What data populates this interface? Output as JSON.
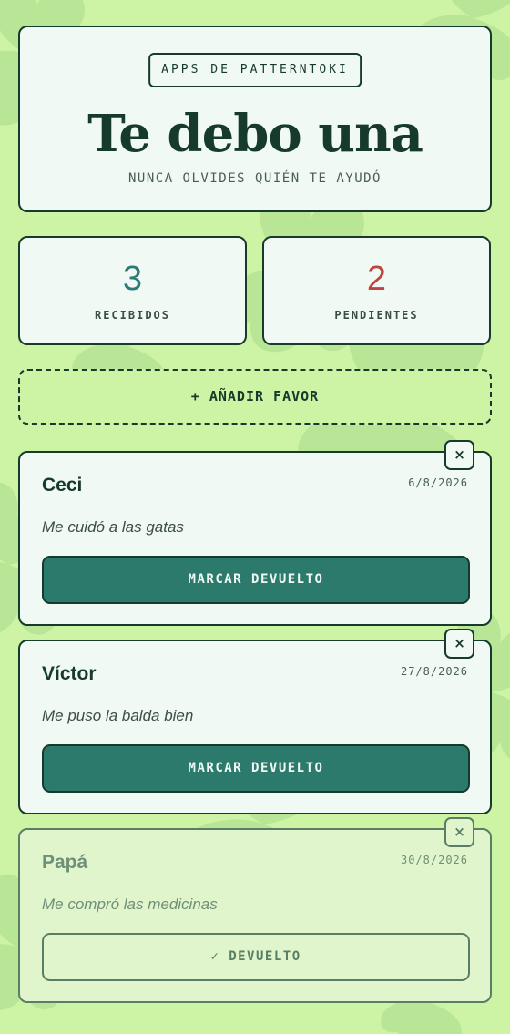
{
  "header": {
    "brand": "APPS DE PATTERNTOKI",
    "title": "Te debo una",
    "subtitle": "NUNCA OLVIDES QUIÉN TE AYUDÓ"
  },
  "stats": {
    "received": {
      "value": "3",
      "label": "RECIBIDOS",
      "color": "#2b7a78"
    },
    "pending": {
      "value": "2",
      "label": "PENDIENTES",
      "color": "#c0443a"
    }
  },
  "add_button": {
    "label": "+ AÑADIR FAVOR"
  },
  "favors": [
    {
      "name": "Ceci",
      "date": "6/8/2026",
      "description": "Me cuidó a las gatas",
      "action": "MARCAR DEVUELTO",
      "close": "×"
    },
    {
      "name": "Víctor",
      "date": "27/8/2026",
      "description": "Me puso la balda bien",
      "action": "MARCAR DEVUELTO",
      "close": "×"
    },
    {
      "name": "Papá",
      "date": "30/8/2026",
      "description": "Me compró las medicinas",
      "action": "✓ DEVUELTO",
      "close": "×"
    }
  ],
  "colors": {
    "background": "#cdf4a4",
    "card": "#f0f9f3",
    "ink": "#163a2c",
    "accent": "#2b7a6c",
    "returned_card": "#e0f5cb"
  }
}
